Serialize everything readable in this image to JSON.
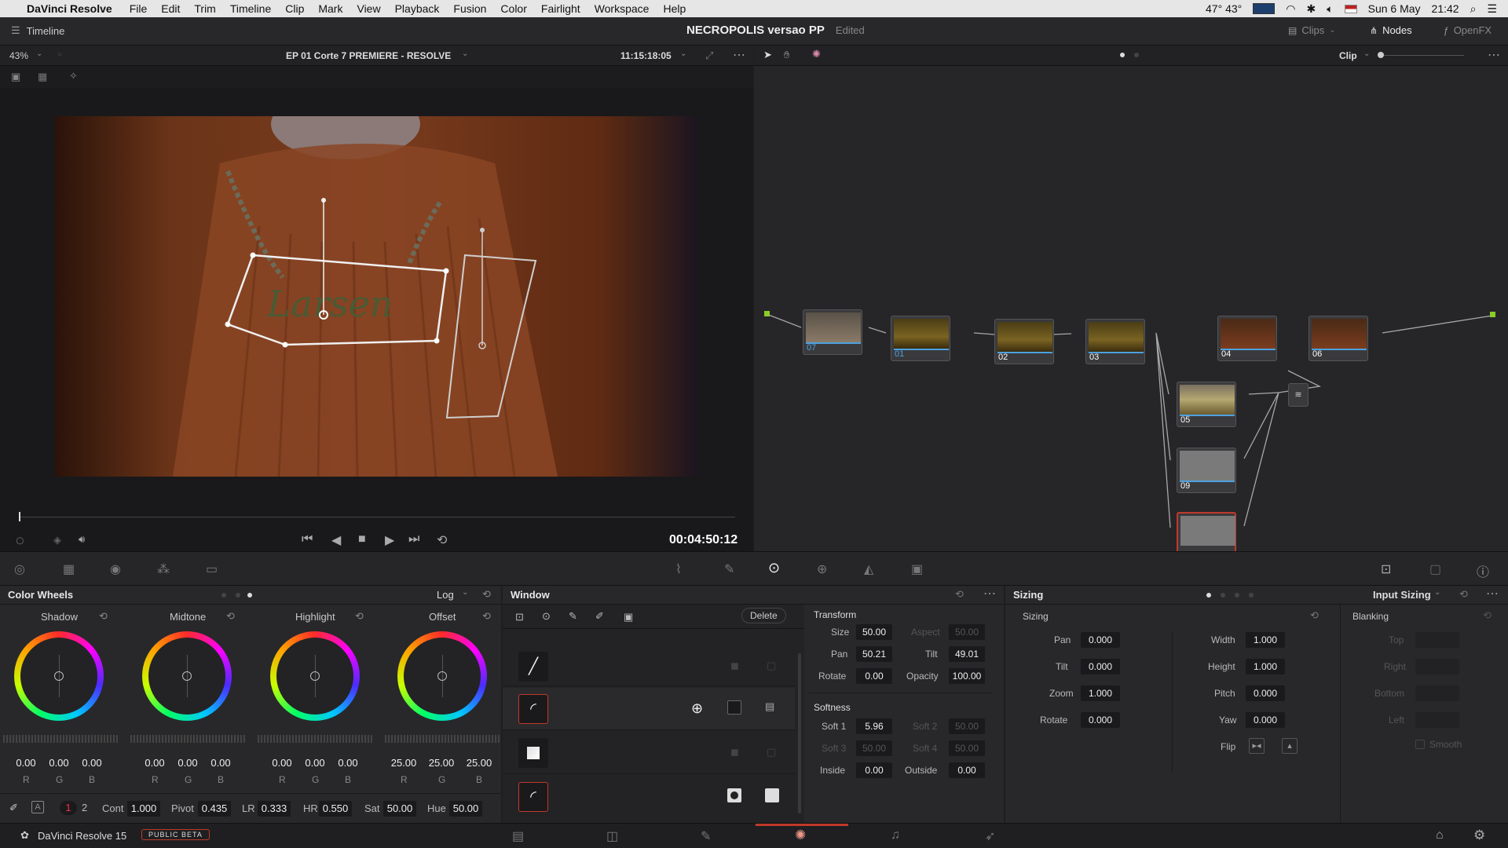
{
  "menubar": {
    "app": "DaVinci Resolve",
    "items": [
      "File",
      "Edit",
      "Trim",
      "Timeline",
      "Clip",
      "Mark",
      "View",
      "Playback",
      "Fusion",
      "Color",
      "Fairlight",
      "Workspace",
      "Help"
    ],
    "temp": "47° 43°",
    "date": "Sun 6 May",
    "time": "21:42"
  },
  "topbar": {
    "timeline": "Timeline",
    "project": "NECROPOLIS versao PP",
    "status": "Edited",
    "clips": "Clips",
    "nodes": "Nodes",
    "openfx": "OpenFX"
  },
  "viewer": {
    "zoom": "43%",
    "clipname": "EP 01 Corte 7 PREMIERE - RESOLVE",
    "timecode": "11:15:18:05",
    "playhead": "00:04:50:12"
  },
  "nodeview": {
    "mode": "Clip"
  },
  "nodes": [
    {
      "num": "07"
    },
    {
      "num": "01"
    },
    {
      "num": "02"
    },
    {
      "num": "03"
    },
    {
      "num": "04"
    },
    {
      "num": "06"
    },
    {
      "num": "05"
    },
    {
      "num": "09"
    }
  ],
  "wheels": {
    "title": "Color Wheels",
    "mode": "Log",
    "items": [
      {
        "name": "Shadow",
        "r": "0.00",
        "g": "0.00",
        "b": "0.00"
      },
      {
        "name": "Midtone",
        "r": "0.00",
        "g": "0.00",
        "b": "0.00"
      },
      {
        "name": "Highlight",
        "r": "0.00",
        "g": "0.00",
        "b": "0.00"
      },
      {
        "name": "Offset",
        "r": "25.00",
        "g": "25.00",
        "b": "25.00"
      }
    ],
    "rgb": [
      "R",
      "G",
      "B"
    ],
    "footer": {
      "page1": "1",
      "page2": "2",
      "cont_label": "Cont",
      "cont": "1.000",
      "pivot_label": "Pivot",
      "pivot": "0.435",
      "lr_label": "LR",
      "lr": "0.333",
      "hr_label": "HR",
      "hr": "0.550",
      "sat_label": "Sat",
      "sat": "50.00",
      "hue_label": "Hue",
      "hue": "50.00"
    }
  },
  "window": {
    "title": "Window",
    "delete": "Delete"
  },
  "transform": {
    "title": "Transform",
    "size_label": "Size",
    "size": "50.00",
    "aspect_label": "Aspect",
    "aspect": "50.00",
    "pan_label": "Pan",
    "pan": "50.21",
    "tilt_label": "Tilt",
    "tilt": "49.01",
    "rotate_label": "Rotate",
    "rotate": "0.00",
    "opacity_label": "Opacity",
    "opacity": "100.00",
    "softness": "Softness",
    "soft1_label": "Soft 1",
    "soft1": "5.96",
    "soft2_label": "Soft 2",
    "soft2": "50.00",
    "soft3_label": "Soft 3",
    "soft3": "50.00",
    "soft4_label": "Soft 4",
    "soft4": "50.00",
    "inside_label": "Inside",
    "inside": "0.00",
    "outside_label": "Outside",
    "outside": "0.00"
  },
  "sizing": {
    "title": "Sizing",
    "mode": "Input Sizing",
    "sub": "Sizing",
    "pan_label": "Pan",
    "pan": "0.000",
    "tilt_label": "Tilt",
    "tilt": "0.000",
    "zoom_label": "Zoom",
    "zoom": "1.000",
    "rotate_label": "Rotate",
    "rotate": "0.000",
    "width_label": "Width",
    "width": "1.000",
    "height_label": "Height",
    "height": "1.000",
    "pitch_label": "Pitch",
    "pitch": "0.000",
    "yaw_label": "Yaw",
    "yaw": "0.000",
    "flip_label": "Flip"
  },
  "blanking": {
    "title": "Blanking",
    "top": "Top",
    "right": "Right",
    "bottom": "Bottom",
    "left": "Left",
    "smooth": "Smooth"
  },
  "bottombar": {
    "product": "DaVinci Resolve 15",
    "badge": "PUBLIC BETA"
  }
}
